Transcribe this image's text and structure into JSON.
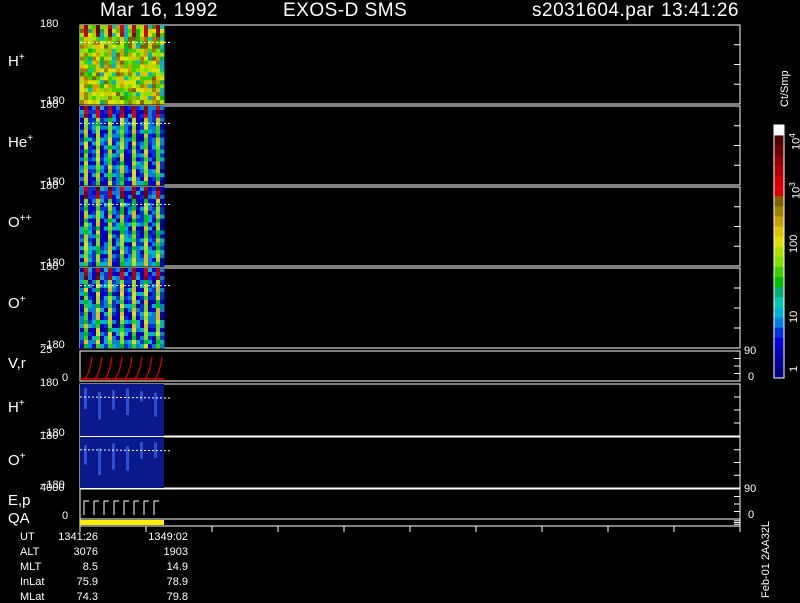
{
  "header": {
    "date": "Mar 16, 1992",
    "instrument": "EXOS-D SMS",
    "file": "s2031604.par",
    "time": "13:41:26"
  },
  "panels": [
    {
      "id": "h1",
      "label": "H",
      "sup": "+",
      "top": "180",
      "bottom": "−180"
    },
    {
      "id": "he",
      "label": "He",
      "sup": "+",
      "top": "180",
      "bottom": "−180"
    },
    {
      "id": "opp",
      "label": "O",
      "sup": "++",
      "top": "180",
      "bottom": "−180"
    },
    {
      "id": "o1",
      "label": "O",
      "sup": "+",
      "top": "180",
      "bottom": "−180"
    },
    {
      "id": "vr",
      "label": "V,r",
      "sup": "",
      "top": "25",
      "bottom": "0",
      "rtop": "90",
      "rbottom": "0"
    },
    {
      "id": "h2",
      "label": "H",
      "sup": "+",
      "top": "180",
      "bottom": "−180"
    },
    {
      "id": "o2",
      "label": "O",
      "sup": "+",
      "top": "180",
      "bottom": "−180"
    },
    {
      "id": "ep",
      "label": "E,p",
      "sup": "",
      "top": "4000",
      "bottom": "0",
      "rtop": "90",
      "rbottom": "0"
    },
    {
      "id": "qa",
      "label": "QA",
      "sup": ""
    }
  ],
  "colorbar": {
    "unit": "Ct/Smp",
    "labels": [
      "1",
      "10",
      "100",
      "10",
      "10"
    ],
    "sups": [
      "",
      "",
      "",
      "3",
      "4"
    ],
    "colors": [
      "#00007f",
      "#000096",
      "#0000b4",
      "#0000d2",
      "#0030e0",
      "#0080e0",
      "#00b0d0",
      "#00c8b0",
      "#00b070",
      "#00c000",
      "#40d000",
      "#80e000",
      "#b0e000",
      "#e0e000",
      "#e0c000",
      "#c8a000",
      "#a08000",
      "#806000",
      "#e00000",
      "#d00000",
      "#b00000",
      "#900000",
      "#700000",
      "#500000",
      "#ffffff"
    ]
  },
  "ephemeris": {
    "labels": [
      "UT",
      "ALT",
      "MLT",
      "InLat",
      "MLat"
    ],
    "col1": [
      "1341:26",
      "3076",
      "8.5",
      "75.9",
      "74.3"
    ],
    "col2": [
      "1349:02",
      "1903",
      "14.9",
      "78.9",
      "79.8"
    ]
  },
  "footer": "Feb-01  2AA32L"
}
